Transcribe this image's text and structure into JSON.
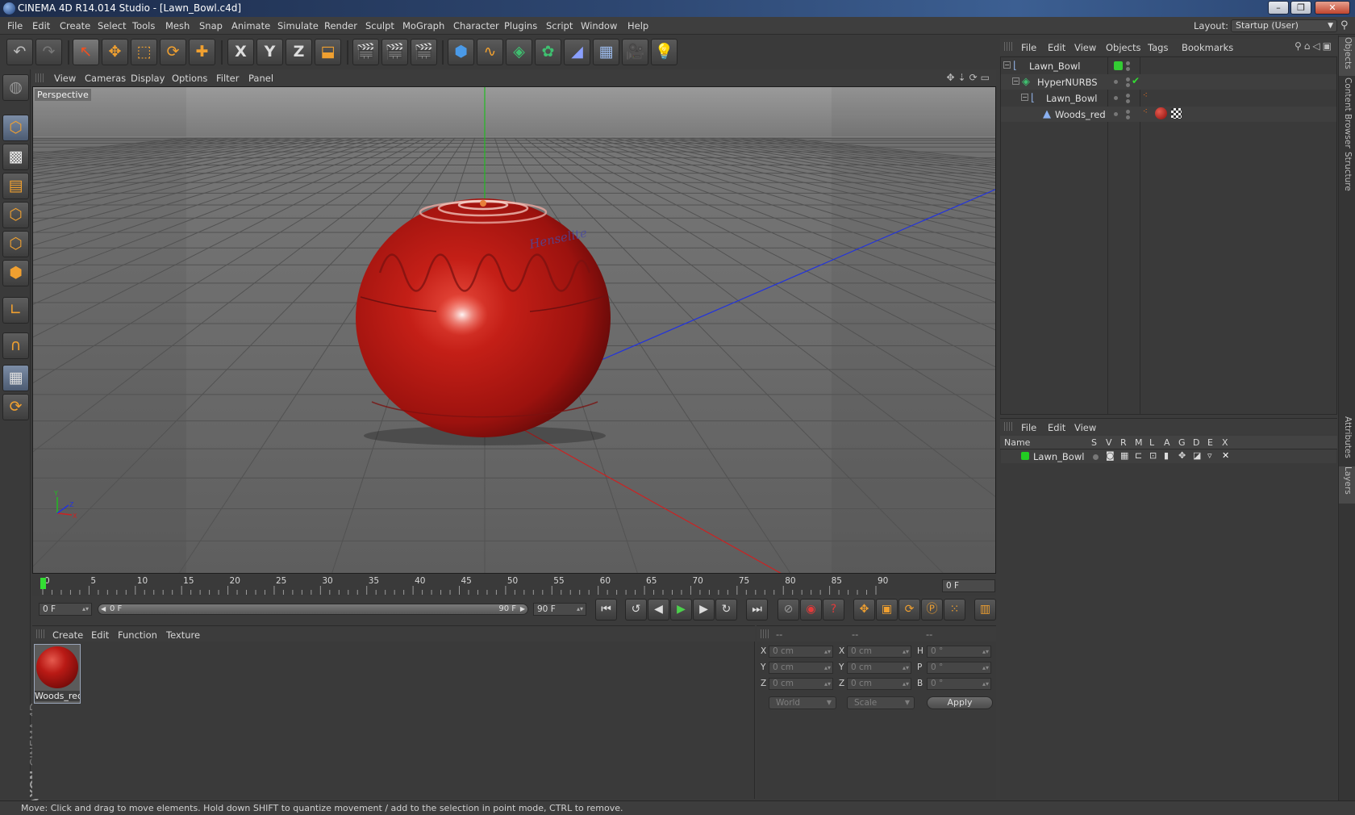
{
  "window": {
    "title": "CINEMA 4D R14.014 Studio - [Lawn_Bowl.c4d]",
    "buttons": [
      "–",
      "❐",
      "✕"
    ]
  },
  "menubar": {
    "items": [
      "File",
      "Edit",
      "Create",
      "Select",
      "Tools",
      "Mesh",
      "Snap",
      "Animate",
      "Simulate",
      "Render",
      "Sculpt",
      "MoGraph",
      "Character",
      "Plugins",
      "Script",
      "Window",
      "Help"
    ],
    "layout_label": "Layout:",
    "layout_value": "Startup (User)"
  },
  "toolbar": {
    "undo": "↶",
    "redo": "↷",
    "live_select": "↖",
    "move": "✥",
    "scale": "⬚",
    "rotate": "⟳",
    "add": "✚",
    "x_axis": "X",
    "y_axis": "Y",
    "z_axis": "Z"
  },
  "viewport": {
    "menu": [
      "View",
      "Cameras",
      "Display",
      "Options",
      "Filter",
      "Panel"
    ],
    "label": "Perspective",
    "nav_icons": "✥⇣⟳▭",
    "brand_text": "Henselite"
  },
  "timeline": {
    "ticks": [
      "0",
      "5",
      "10",
      "15",
      "20",
      "25",
      "30",
      "35",
      "40",
      "45",
      "50",
      "55",
      "60",
      "65",
      "70",
      "75",
      "80",
      "85",
      "90"
    ],
    "current_frame": "0 F",
    "start_field": "0 F",
    "range_start": "0 F",
    "range_end": "90 F",
    "end_field": "90 F"
  },
  "materials": {
    "menu": [
      "Create",
      "Edit",
      "Function",
      "Texture"
    ],
    "items": [
      {
        "name": "Woods_red"
      }
    ]
  },
  "coordinates": {
    "headers": [
      "--",
      "--",
      "--"
    ],
    "rows": [
      {
        "a": "X",
        "av": "0 cm",
        "b": "X",
        "bv": "0 cm",
        "c": "H",
        "cv": "0 °"
      },
      {
        "a": "Y",
        "av": "0 cm",
        "b": "Y",
        "bv": "0 cm",
        "c": "P",
        "cv": "0 °"
      },
      {
        "a": "Z",
        "av": "0 cm",
        "b": "Z",
        "bv": "0 cm",
        "c": "B",
        "cv": "0 °"
      }
    ],
    "mode": "World",
    "type": "Scale",
    "apply": "Apply"
  },
  "objects": {
    "menu": [
      "File",
      "Edit",
      "View",
      "Objects",
      "Tags",
      "Bookmarks"
    ],
    "tree": [
      {
        "name": "Lawn_Bowl"
      },
      {
        "name": "HyperNURBS"
      },
      {
        "name": "Lawn_Bowl"
      },
      {
        "name": "Woods_red"
      }
    ]
  },
  "layers": {
    "menu": [
      "File",
      "Edit",
      "View"
    ],
    "headers": [
      "Name",
      "S",
      "V",
      "R",
      "M",
      "L",
      "A",
      "G",
      "D",
      "E",
      "X"
    ],
    "rows": [
      {
        "name": "Lawn_Bowl",
        "color": "#22cc22"
      }
    ]
  },
  "right_tabs": [
    "Objects",
    "Content Browser",
    "Structure",
    "Attributes",
    "Layers"
  ],
  "brand": {
    "maxon": "MAXON",
    "cinema": "CINEMA 4D"
  },
  "status": "Move: Click and drag to move elements. Hold down SHIFT to quantize movement / add to the selection in point mode, CTRL to remove.",
  "colors": {
    "bowl": "#b81c16",
    "x_axis": "#cc2222",
    "y_axis": "#22bb22",
    "z_axis": "#2233dd",
    "accent": "#f0a030"
  }
}
